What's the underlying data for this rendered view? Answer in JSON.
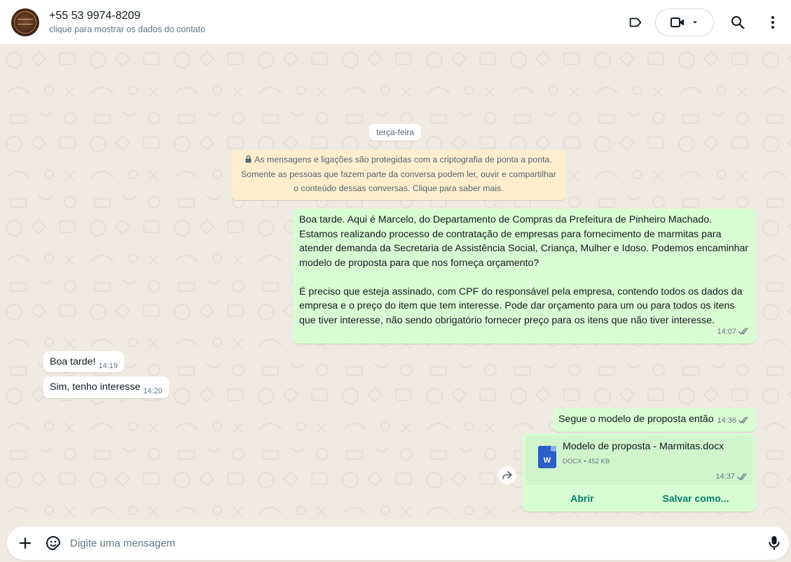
{
  "header": {
    "contact_name": "+55 53 9974-8209",
    "contact_subtitle": "clique para mostrar os dados do contato",
    "icons": [
      "avatar",
      "label-icon",
      "video-call-icon",
      "chevron-down-icon",
      "search-icon",
      "more-vert-icon"
    ]
  },
  "chat": {
    "date_label": "terça-feira",
    "encryption_notice": {
      "line1": "As mensagens e ligações são protegidas com a criptografia de ponta a ponta.",
      "line2": "Somente as pessoas que fazem parte da conversa podem ler, ouvir e compartilhar",
      "line3": "o conteúdo dessas conversas. Clique para saber mais."
    },
    "messages": [
      {
        "direction": "out",
        "paragraph1": "Boa tarde. Aqui é Marcelo, do Departamento de Compras da Prefeitura de Pinheiro Machado. Estamos realizando processo de contratação de empresas para fornecimento de marmitas para atender demanda da Secretaria de Assistência Social, Criança, Mulher e Idoso. Podemos encaminhar modelo de proposta para que nos forneça orçamento?",
        "paragraph2": "É preciso que esteja assinado, com CPF do responsável pela empresa, contendo todos os dados da empresa e o preço do item que tem interesse. Pode dar orçamento para um ou para todos os itens que tiver interesse, não sendo obrigatório fornecer preço para os itens que não tiver interesse.",
        "time": "14:07"
      },
      {
        "direction": "in",
        "text": "Boa tarde!",
        "time": "14:19"
      },
      {
        "direction": "in",
        "text": "Sim, tenho interesse",
        "time": "14:20"
      },
      {
        "direction": "out",
        "text": "Segue o modelo de proposta então",
        "time": "14:36"
      }
    ],
    "document": {
      "icon_letter": "W",
      "file_name": "Modelo de proposta - Marmitas.docx",
      "file_info": "DOCX • 452 KB",
      "time": "14:37",
      "open_label": "Abrir",
      "save_label": "Salvar como..."
    }
  },
  "composer": {
    "placeholder": "Digite uma mensagem"
  },
  "colors": {
    "outgoing_bubble": "#d9fdd3",
    "incoming_bubble": "#ffffff",
    "chat_background": "#efeae2",
    "encryption_notice": "#ffeecd",
    "accent": "#008069",
    "read_ticks": "#667781"
  }
}
